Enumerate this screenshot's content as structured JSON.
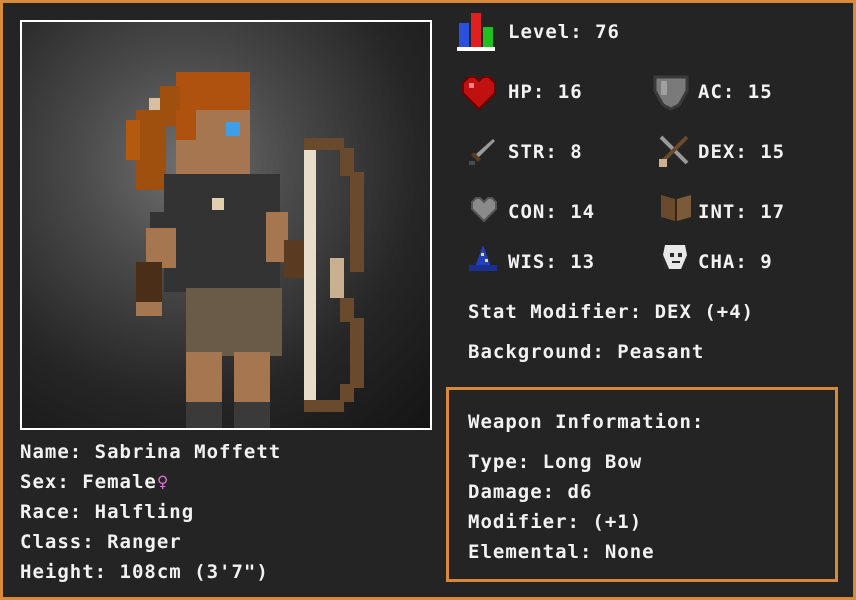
{
  "character": {
    "name_line": "Name: Sabrina Moffett",
    "sex_line": "Sex: Female",
    "sex_symbol": "♀",
    "race_line": "Race: Halfling",
    "class_line": "Class: Ranger",
    "height_line": "Height: 108cm (3'7\")"
  },
  "stats": {
    "level": "Level: 76",
    "hp": "HP: 16",
    "ac": "AC: 15",
    "str": "STR: 8",
    "dex": "DEX: 15",
    "con": "CON: 14",
    "int": "INT: 17",
    "wis": "WIS: 13",
    "cha": "CHA: 9",
    "stat_modifier": "Stat Modifier: DEX (+4)",
    "background": "Background: Peasant"
  },
  "weapon": {
    "header": "Weapon Information:",
    "type": "Type: Long Bow",
    "damage": "Damage: d6",
    "modifier": "Modifier: (+1)",
    "elemental": "Elemental: None"
  },
  "icons": {
    "level": "level-bars-icon",
    "hp": "heart-icon",
    "ac": "shield-icon",
    "str": "sword-icon",
    "dex": "crossed-daggers-icon",
    "con": "gray-heart-icon",
    "int": "book-icon",
    "wis": "wizard-hat-icon",
    "cha": "mask-icon"
  },
  "colors": {
    "accent_border": "#d8893a",
    "background": "#242424",
    "text": "#f2f2f2",
    "sex_symbol": "#e070d8"
  }
}
